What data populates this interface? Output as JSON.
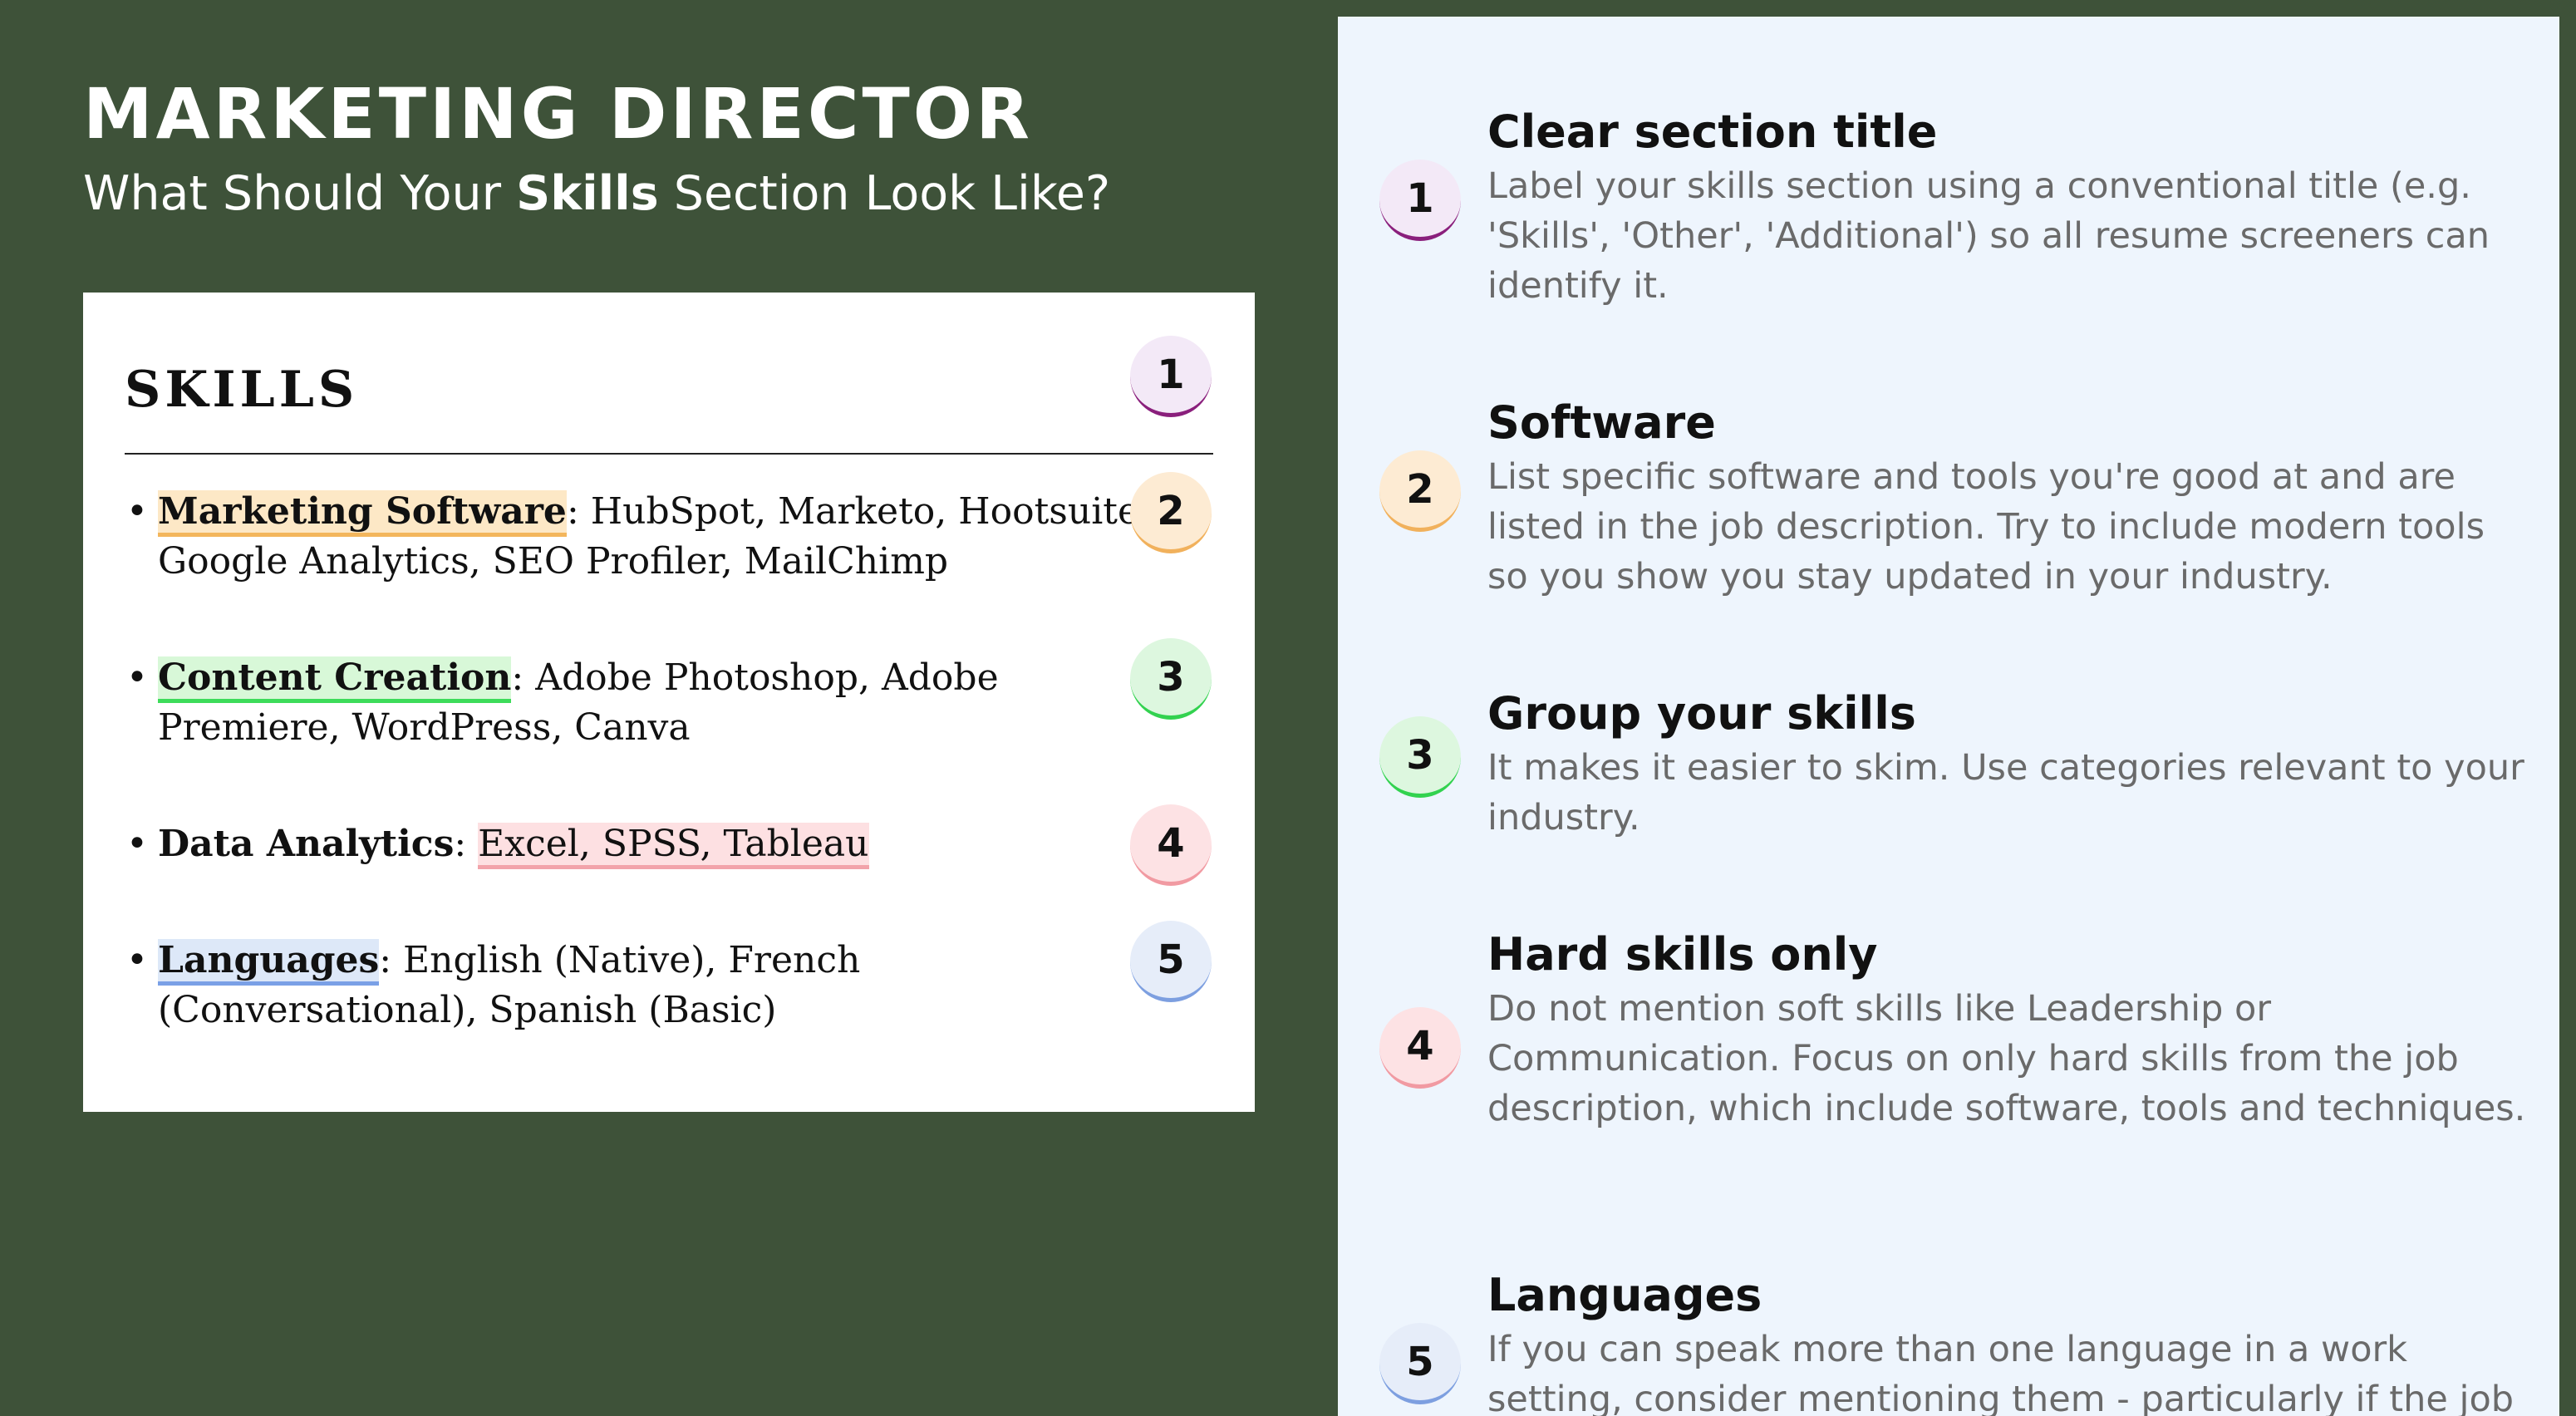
{
  "header": {
    "title": "MARKETING DIRECTOR",
    "subtitle_before": "What Should Your ",
    "subtitle_bold": "Skills",
    "subtitle_after": " Section Look Like?"
  },
  "resume": {
    "heading": "SKILLS",
    "items": [
      {
        "category": "Marketing Software",
        "separator": ": ",
        "values": "HubSpot, Marketo, Hootsuite, Google Analytics, SEO Profiler, MailChimp"
      },
      {
        "category": "Content Creation",
        "separator": ": ",
        "values": "Adobe Photoshop, Adobe Premiere, WordPress, Canva"
      },
      {
        "category": "Data Analytics",
        "separator": ": ",
        "values": "Excel, SPSS, Tableau"
      },
      {
        "category": "Languages",
        "separator": ": ",
        "values": "English (Native), French (Conversational), Spanish (Basic)"
      }
    ],
    "badges": [
      "1",
      "2",
      "3",
      "4",
      "5"
    ]
  },
  "tips": [
    {
      "number": "1",
      "title": "Clear section title",
      "description": "Label your skills section using a conventional title (e.g. 'Skills', 'Other', 'Additional') so all resume screeners can identify it."
    },
    {
      "number": "2",
      "title": "Software",
      "description": "List specific software and tools you're good at and are listed in the job description. Try to include modern tools so you show you stay updated in your industry."
    },
    {
      "number": "3",
      "title": "Group your skills",
      "description": "It makes it easier to skim. Use categories relevant to your industry."
    },
    {
      "number": "4",
      "title": "Hard skills only",
      "description": "Do not mention soft skills like Leadership or Communication. Focus on only hard skills from the job description, which include software, tools and techniques."
    },
    {
      "number": "5",
      "title": "Languages",
      "description": "If you can speak more than one language in a work setting, consider mentioning them - particularly if the job"
    }
  ],
  "colors": {
    "background": "#3e5239",
    "panel": "#eef5fd",
    "badge_1": "#8a1f7c",
    "badge_2": "#f1b15c",
    "badge_3": "#32d24f",
    "badge_4": "#f19aa2",
    "badge_5": "#7d9fe0"
  }
}
